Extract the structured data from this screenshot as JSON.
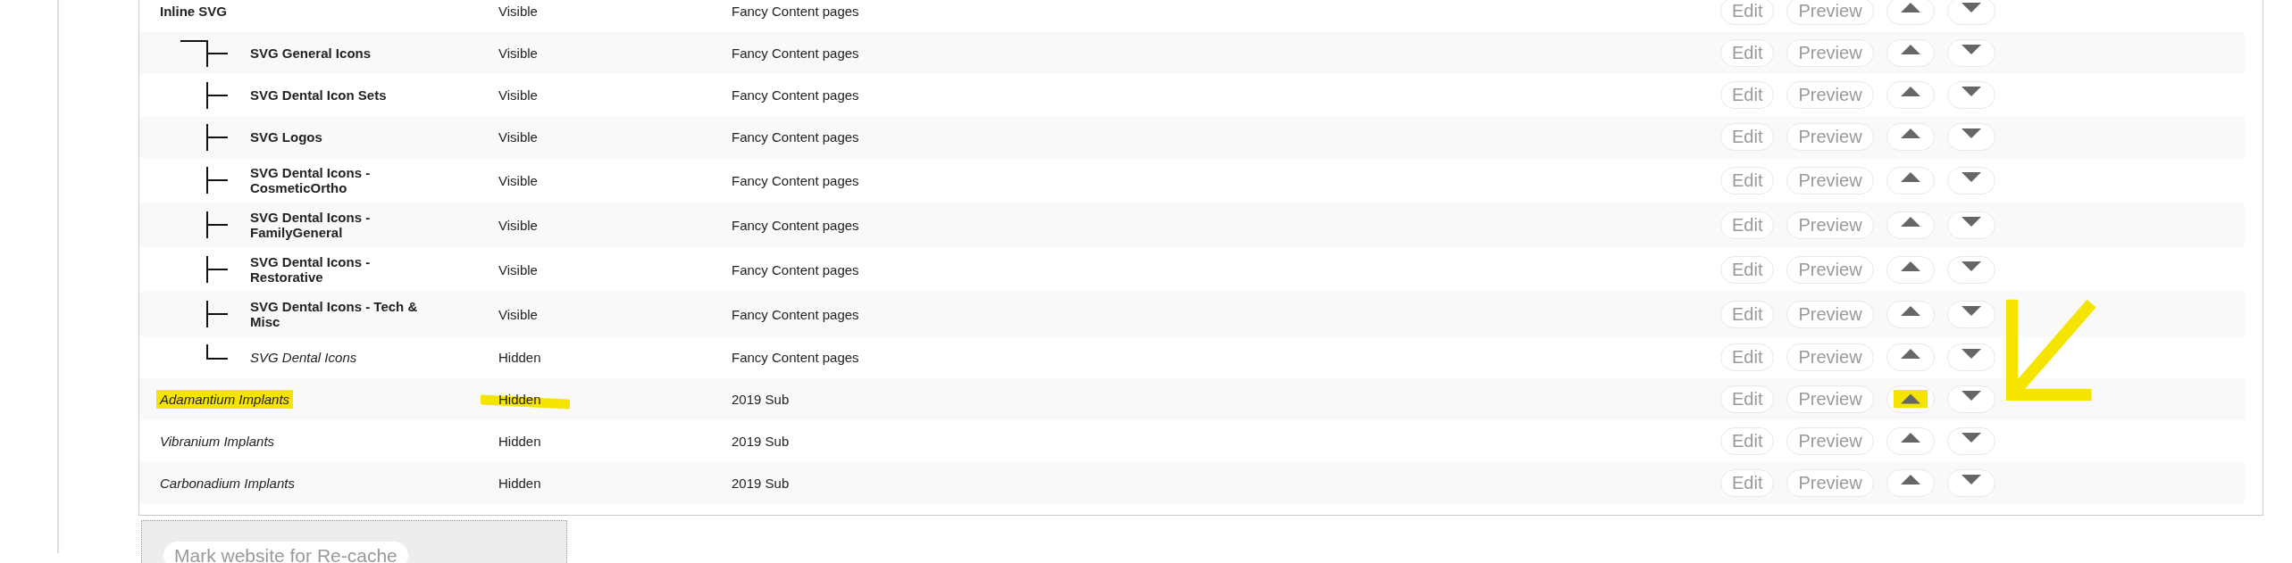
{
  "rows": [
    {
      "name": "Inline SVG",
      "visible": true,
      "status": "Visible",
      "page": "Fancy Content pages",
      "actions": [
        "Edit",
        "Preview"
      ],
      "children": [
        {
          "kind": "first",
          "name": "SVG General Icons",
          "visible": true,
          "status": "Visible",
          "page": "Fancy Content pages",
          "actions": [
            "Edit",
            "Preview"
          ]
        },
        {
          "kind": "middle",
          "name": "SVG Dental Icon Sets",
          "visible": true,
          "status": "Visible",
          "page": "Fancy Content pages",
          "actions": [
            "Edit",
            "Preview"
          ]
        },
        {
          "kind": "middle",
          "name": "SVG Logos",
          "visible": true,
          "status": "Visible",
          "page": "Fancy Content pages",
          "actions": [
            "Edit",
            "Preview"
          ]
        },
        {
          "kind": "middle",
          "name": "SVG Dental Icons - CosmeticOrtho",
          "visible": true,
          "status": "Visible",
          "page": "Fancy Content pages",
          "actions": [
            "Edit",
            "Preview"
          ]
        },
        {
          "kind": "middle",
          "name": "SVG Dental Icons - FamilyGeneral",
          "visible": true,
          "status": "Visible",
          "page": "Fancy Content pages",
          "actions": [
            "Edit",
            "Preview"
          ]
        },
        {
          "kind": "middle",
          "name": "SVG Dental Icons - Restorative",
          "visible": true,
          "status": "Visible",
          "page": "Fancy Content pages",
          "actions": [
            "Edit",
            "Preview"
          ]
        },
        {
          "kind": "middle",
          "name": "SVG Dental Icons - Tech & Misc",
          "visible": true,
          "status": "Visible",
          "page": "Fancy Content pages",
          "actions": [
            "Edit",
            "Preview"
          ]
        },
        {
          "kind": "last",
          "name": "SVG Dental Icons",
          "visible": false,
          "status": "Hidden",
          "page": "Fancy Content pages",
          "actions": [
            "Edit",
            "Preview"
          ]
        }
      ]
    },
    {
      "name": "Adamantium Implants",
      "visible": false,
      "status": "Hidden",
      "page": "2019 Sub",
      "actions": [
        "Edit",
        "Preview"
      ],
      "name_marked": true,
      "status_marked": true,
      "up_marked": true
    },
    {
      "name": "Vibranium Implants",
      "visible": false,
      "status": "Hidden",
      "page": "2019 Sub",
      "actions": [
        "Edit",
        "Preview"
      ]
    },
    {
      "name": "Carbonadium Implants",
      "visible": false,
      "status": "Hidden",
      "page": "2019 Sub",
      "actions": [
        "Edit",
        "Preview"
      ]
    }
  ],
  "arrow_annotation": true,
  "recache_button": "Mark website for Re-cache"
}
